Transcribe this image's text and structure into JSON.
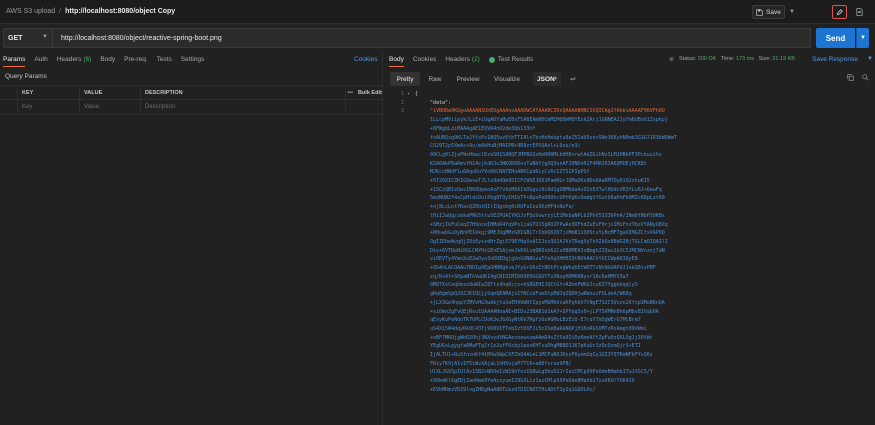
{
  "topbar": {
    "breadcrumb_parent": "AWS S3 upload",
    "separator": "/",
    "breadcrumb_current": "http://localhost:8080/object Copy",
    "save_label": "Save",
    "save_icon": "save-icon",
    "edit_icon": "pencil-icon",
    "doc_icon": "document-icon"
  },
  "request": {
    "method": "GET",
    "url": "http://localhost:8080/object/reactive-spring-boot.png",
    "send_label": "Send"
  },
  "left": {
    "tabs": [
      {
        "label": "Params",
        "count": ""
      },
      {
        "label": "Auth",
        "count": ""
      },
      {
        "label": "Headers",
        "count": "(6)"
      },
      {
        "label": "Body",
        "count": ""
      },
      {
        "label": "Pre-req.",
        "count": ""
      },
      {
        "label": "Tests",
        "count": ""
      },
      {
        "label": "Settings",
        "count": ""
      }
    ],
    "cookies_link": "Cookies",
    "query_params_title": "Query Params",
    "table": {
      "headers": [
        "KEY",
        "VALUE",
        "DESCRIPTION"
      ],
      "more_icon": "•••",
      "bulk_edit": "Bulk Edit",
      "placeholder_row": [
        "Key",
        "Value",
        "Description"
      ]
    }
  },
  "right": {
    "tabs": [
      {
        "label": "Body",
        "count": ""
      },
      {
        "label": "Cookies",
        "count": ""
      },
      {
        "label": "Headers",
        "count": "(2)"
      },
      {
        "label": "Test Results",
        "count": ""
      }
    ],
    "status_label": "Status:",
    "status_value": "200 OK",
    "time_label": "Time:",
    "time_value": "173 ms",
    "size_label": "Size:",
    "size_value": "21.19 KB",
    "save_response": "Save Response",
    "view_modes": [
      "Pretty",
      "Raw",
      "Preview",
      "Visualize"
    ],
    "format": "JSON",
    "line_numbers": [
      "1",
      "2",
      "3"
    ],
    "open_brace": "{",
    "data_key": "\"data\":",
    "data_lines": [
      "\"iVBORw0KGgoAAAANSUhEUgAAAnoAAADWCAYAAABCIRcQAAAABHNCSVQICAgIfAhkiAAAAF96VFh0U",
      "1LLcpMViipyk/LiE+iUgADYaMuE0sT5A6EAmHDCmMIMQQmMQYExkZAtj1GNNEA2IyYm6UBob1Zxpkpj",
      "+6FWgbLdiMAAAgAE1EQVR4nO2de3Qb133nf",
      "fnAUBQsg9KLTe2YtxPx1BQ5uzEthTTIAlvTbvHnHebptu8eZ5IaU5onvSNn3KKyhN0mb3G1G71R3bWUWmT",
      "CO29T2p5XmAc+9v/mAkHuBjMAIPB+9R8zrEPSQAzl+L9zu/e3/",
      "09CLg0lZjaFWxHbwclEceSH1SABQFJMPBGQsKmH0RMLb0H0xrwtAdZGihNzSLM1HBkPF3Pcbuuihz",
      "KSA6AkPBaRmvfH14cjkdDJu3WKOK66nsTuNhYjgXQ3onAFJ0NDnR2F4MAI63A6QMUEjHCK8t",
      "MJKccHWdF1u6AqoDuYVo6KCNATEHoABKCpd6LyCcRcIITSIPIpPSf",
      "+5T26XICZKIGQevwTJLlo9d4Qm9SICFCWSEJQ5JPamRGrJQMuDKx9Do6AaKMTOyDiQ2xhuKI5",
      "+15CzQBIzDwsIB60OpeoAzP7v9zMAXIkDGgvi0i0d1gOBMKda4sOInEXTwlHUdcVR3fLu6J+6ewFq",
      "5mzNUW2f4xCpHldcDulPbg8TOyIHIbTP+BpnPeU0OhcUPtKgKx5mdgVfGutO6aPmFk0MZcKBpLzt60",
      "+oj8LcLntYKasQZ6GtQIrIQgsbg0cRUFuIzuSKzHF4cNzFa/",
      "lHiIJaQgcvbkaPNG5ttuSEZPUAIYRSJzFQuVowrzjLE1MnbaNPLbZPhV5IU36PnA/2Nm0fNbP3OKBx",
      "+SHzjIkFuCeqZ7HSnceIHMoR4YqVPs1jaGTO15gRO2PPwAv3OFhdZuEvF0rjsIMiFnzTbsVYANyO8Xq",
      "+00uwbGu0yBnPE1kkgj9MEJUgMMzG0IGBLTrIbbQ8Z07jiMmB1iQ0StuYyBcMF7gaUIMGZCfxVAPOQ",
      "OgIIEbeWvgQjZ0sEy+zdHrZgi579EYHpXsAIIJxcQU1AJVzTRagXyTnXZkQo8BdGIBjTGLCmOIQAIlI",
      "Div+6VTDeNiKGLCNYHiGEnESAjnmJk6VLvqQROxb62CuHBOMEA3xBmghIIQau1k3C5JMCNVnzoj7dN",
      "vi0EVTy4YmoXsE2wOyo3nDUEDgjgUnGUNBGzaTfeXqXHH0IQtNUhAACkYUCCWpAK3QyEB",
      "+0G4nLACQAAu7BDIp0EpGHNBgkveJYyGrG6zItBDtPtvgWhq6EtWOTTsNtNUdAPdJ1nkQ0ivPBF",
      "zq/R+Af+SPpaWTkVwUK14gCNIOIMIKR0ERGG6UYTuVNoyHOMKRByvr16c6eHMYV3a7",
      "0M97XsCeqUmzu9wWIaZ8Ttz4hqOcjx+hGBGEHIJQCtGf+RZmnFWKGJcu6ZYYggkbqqlyS",
      "gRq0gmSpQ29ZJKIQCjySqmQEAMAjsIYNCcdFvm5tpEWJqZQDHjwRWouzFOLdeA/W68q",
      "+jLX3Ge9hppYZMVvHG3wdkjtuSeEHXkWUtIpyoMGMhUcaKFqhbV7tNgE7S2CSVvzn26fnp3MoB6nQA",
      "+siOmnZgFvQEjRsu1QAAAAHnaAE+BIDs23BAB1d1kA7+SPYqqSs0+jLPTSVMNnBk6pMbvBIVqGOA",
      "qExyKuPeNdoTK7UPLCUoK2eJbXGyNtRk7RgYzUzAGMoLBzEiU-E7ruYTm5gWErG7MlBrm7",
      "uS4X15W4dqyRkOC43Tj9O0VIFTebIztDXFJi5cISeBaRkNQPjH1KxRGSVMTzRxAmgt09VWmi",
      "+oBF7M6OjgWhD2Ohj3NXvydVNGAesoewxsmAAmD4xZYXa9IiDzKmnAYtZpFu0zQXLOgJj3OtWr",
      "YEgUGsLgygfa6MaFTg2r1z2ufFUcby1pexKHTvuDhgMB8D11K7pKuUc3zDcQzmQjrS+ETI",
      "IjALTU1+RuSfnznKf4tMXwSWpCXFZbQ4ALeL1MCFuNOJKnsF6yemUqIy1GI3Y9TRmNFkFYsQ6s",
      "FRiy7K9jA1vIF5iWvXAjaL1hHXvjaP7TC6+a80fsruo9FB/",
      "UlXLJGVSpIUlAx15B2sWDOeIcW19hYnzIQ8wLg5bu52JrIaiCMlpXXPeOdeBHahb1TuJXSC5/Y",
      "+90kmKl6gEDjZanRmm9YeAcxyumIZ9GXLiz1asCMlpXXPeOdeBHahb1TyuVKU/YUK4JO",
      "+EVbMRmzVD29lvgZHRgNaA8RTLbzd7DICNOTTHiADtTSy2q1GQOLAc/"
    ]
  }
}
